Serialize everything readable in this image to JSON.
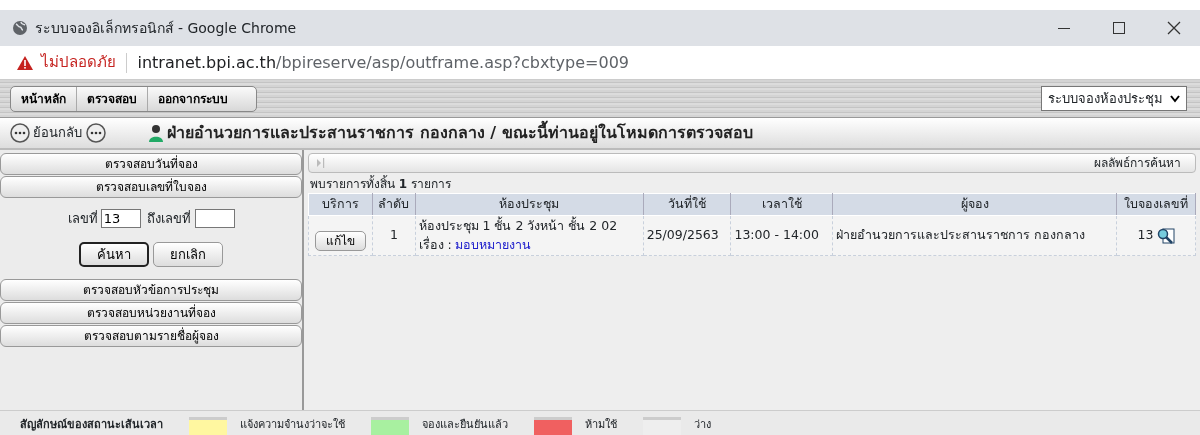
{
  "window": {
    "title": "ระบบจองอิเล็กทรอนิกส์ - Google Chrome"
  },
  "address_bar": {
    "warning": "ไม่ปลอดภัย",
    "host": "intranet.bpi.ac.th",
    "path": "/bpireserve/asp/outframe.asp?cbxtype=009"
  },
  "toolbar": {
    "menu": [
      "หน้าหลัก",
      "ตรวจสอบ",
      "ออกจากระบบ"
    ],
    "system_select": "ระบบจองห้องประชุม"
  },
  "header": {
    "back": "ย้อนกลับ",
    "title": "ฝ่ายอำนวยการและประสานราชการ กองกลาง / ขณะนี้ท่านอยู่ในโหมดการตรวจสอบ"
  },
  "sidebar": {
    "sections": [
      {
        "label": "ตรวจสอบวันที่จอง"
      },
      {
        "label": "ตรวจสอบเลขที่ใบจอง",
        "form": {
          "from_label": "เลขที่",
          "from_value": "13",
          "to_label": "ถึงเลขที่",
          "buttons": [
            {
              "label": "ค้นหา",
              "focused": true
            },
            {
              "label": "ยกเลิก",
              "focused": false
            }
          ]
        }
      },
      {
        "label": "ตรวจสอบหัวข้อการประชุม"
      },
      {
        "label": "ตรวจสอบหน่วยงานที่จอง"
      },
      {
        "label": "ตรวจสอบตามรายชื่อผู้จอง"
      }
    ]
  },
  "results": {
    "title": "ผลลัพธ์การค้นหา",
    "summary": "พบรายการทั้งสิ้น **1** รายการ",
    "table": {
      "columns": [
        "บริการ",
        "ลำดับ",
        "ห้องประชุม",
        "วันที่ใช้",
        "เวลาใช้",
        "ผู้จอง",
        "ใบจองเลขที่"
      ],
      "rows": [
        {
          "action": "แก้ไข",
          "number": "1",
          "room": "ห้องประชุม 1 ชั้น 2 วังหน้า ชั้น 2 02",
          "subject_label": "เรื่อง :",
          "subject": "มอบหมายงาน",
          "date": "25/09/2563",
          "time": "13:00 - 14:00",
          "booker": "ฝ่ายอำนวยการและประสานราชการ กองกลาง",
          "booking_no": "13"
        }
      ]
    }
  },
  "legend": {
    "title": "สัญลักษณ์ของสถานะเส้นเวลา",
    "items": [
      {
        "label": "แจ้งความจำนงว่าจะใช้",
        "color": "#fff7a0"
      },
      {
        "label": "จองและยืนยันแล้ว",
        "color": "#a8f0a0"
      },
      {
        "label": "ห้ามใช้",
        "color": "#f06060"
      },
      {
        "label": "ว่าง",
        "color": "#eeeeee"
      }
    ]
  }
}
